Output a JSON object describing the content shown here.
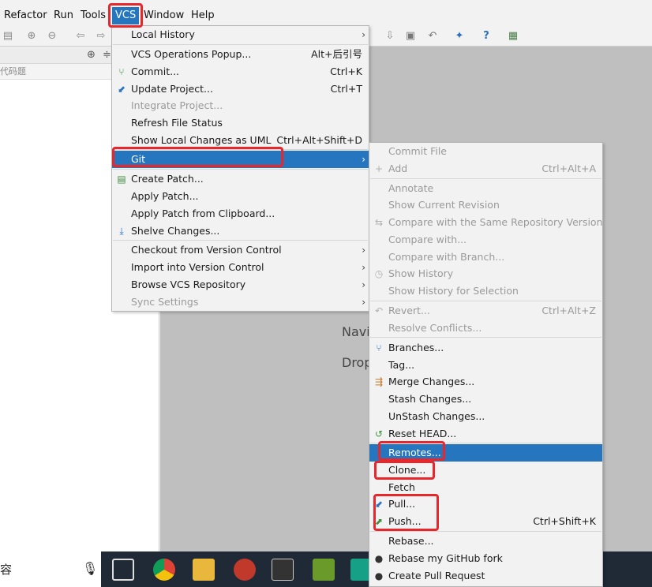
{
  "menubar": {
    "items": [
      "Refactor",
      "Run",
      "Tools",
      "VCS",
      "Window",
      "Help"
    ]
  },
  "left_panel": {
    "sub_text": "代码题"
  },
  "editor": {
    "hint_navigate": "Navi",
    "hint_drop": "Drop"
  },
  "taskbar": {
    "search_char": "容"
  },
  "vcs_menu": {
    "items": [
      {
        "label": "Local History",
        "shortcut": "",
        "submenu": true,
        "disabled": false
      },
      {
        "label": "VCS Operations Popup...",
        "shortcut": "Alt+后引号",
        "submenu": false,
        "disabled": false
      },
      {
        "label": "Commit...",
        "shortcut": "Ctrl+K",
        "submenu": false,
        "disabled": false,
        "icon": "commit-icon"
      },
      {
        "label": "Update Project...",
        "shortcut": "Ctrl+T",
        "submenu": false,
        "disabled": false,
        "icon": "update-icon"
      },
      {
        "label": "Integrate Project...",
        "shortcut": "",
        "submenu": false,
        "disabled": true
      },
      {
        "label": "Refresh File Status",
        "shortcut": "",
        "submenu": false,
        "disabled": false
      },
      {
        "label": "Show Local Changes as UML",
        "shortcut": "Ctrl+Alt+Shift+D",
        "submenu": false,
        "disabled": false
      },
      {
        "label": "Git",
        "shortcut": "",
        "submenu": true,
        "disabled": false,
        "selected": true
      },
      {
        "label": "Create Patch...",
        "shortcut": "",
        "submenu": false,
        "disabled": false,
        "icon": "patch-icon"
      },
      {
        "label": "Apply Patch...",
        "shortcut": "",
        "submenu": false,
        "disabled": false
      },
      {
        "label": "Apply Patch from Clipboard...",
        "shortcut": "",
        "submenu": false,
        "disabled": false
      },
      {
        "label": "Shelve Changes...",
        "shortcut": "",
        "submenu": false,
        "disabled": false,
        "icon": "shelve-icon"
      },
      {
        "label": "Checkout from Version Control",
        "shortcut": "",
        "submenu": true,
        "disabled": false
      },
      {
        "label": "Import into Version Control",
        "shortcut": "",
        "submenu": true,
        "disabled": false
      },
      {
        "label": "Browse VCS Repository",
        "shortcut": "",
        "submenu": true,
        "disabled": false
      },
      {
        "label": "Sync Settings",
        "shortcut": "",
        "submenu": true,
        "disabled": true
      }
    ]
  },
  "git_menu": {
    "items": [
      {
        "label": "Commit File",
        "shortcut": "",
        "disabled": true
      },
      {
        "label": "Add",
        "shortcut": "Ctrl+Alt+A",
        "disabled": true,
        "icon": "add-icon"
      },
      {
        "label": "Annotate",
        "shortcut": "",
        "disabled": true
      },
      {
        "label": "Show Current Revision",
        "shortcut": "",
        "disabled": true
      },
      {
        "label": "Compare with the Same Repository Version",
        "shortcut": "",
        "disabled": true,
        "icon": "compare-icon"
      },
      {
        "label": "Compare with...",
        "shortcut": "",
        "disabled": true
      },
      {
        "label": "Compare with Branch...",
        "shortcut": "",
        "disabled": true
      },
      {
        "label": "Show History",
        "shortcut": "",
        "disabled": true,
        "icon": "history-icon"
      },
      {
        "label": "Show History for Selection",
        "shortcut": "",
        "disabled": true
      },
      {
        "label": "Revert...",
        "shortcut": "Ctrl+Alt+Z",
        "disabled": true,
        "icon": "revert-icon"
      },
      {
        "label": "Resolve Conflicts...",
        "shortcut": "",
        "disabled": true
      },
      {
        "label": "Branches...",
        "shortcut": "",
        "disabled": false,
        "icon": "branches-icon"
      },
      {
        "label": "Tag...",
        "shortcut": "",
        "disabled": false
      },
      {
        "label": "Merge Changes...",
        "shortcut": "",
        "disabled": false,
        "icon": "merge-icon"
      },
      {
        "label": "Stash Changes...",
        "shortcut": "",
        "disabled": false
      },
      {
        "label": "UnStash Changes...",
        "shortcut": "",
        "disabled": false
      },
      {
        "label": "Reset HEAD...",
        "shortcut": "",
        "disabled": false,
        "icon": "reset-icon"
      },
      {
        "label": "Remotes...",
        "shortcut": "",
        "disabled": false,
        "selected": true
      },
      {
        "label": "Clone...",
        "shortcut": "",
        "disabled": false
      },
      {
        "label": "Fetch",
        "shortcut": "",
        "disabled": false
      },
      {
        "label": "Pull...",
        "shortcut": "",
        "disabled": false,
        "icon": "pull-icon"
      },
      {
        "label": "Push...",
        "shortcut": "Ctrl+Shift+K",
        "disabled": false,
        "icon": "push-icon"
      },
      {
        "label": "Rebase...",
        "shortcut": "",
        "disabled": false
      },
      {
        "label": "Rebase my GitHub fork",
        "shortcut": "",
        "disabled": false,
        "icon": "github-icon"
      },
      {
        "label": "Create Pull Request",
        "shortcut": "",
        "disabled": false,
        "icon": "github-icon"
      }
    ]
  },
  "colors": {
    "selection": "#2675bf",
    "highlight_box": "#e8272c",
    "editor_bg": "#bfbfbf",
    "menu_bg": "#f2f2f2"
  }
}
